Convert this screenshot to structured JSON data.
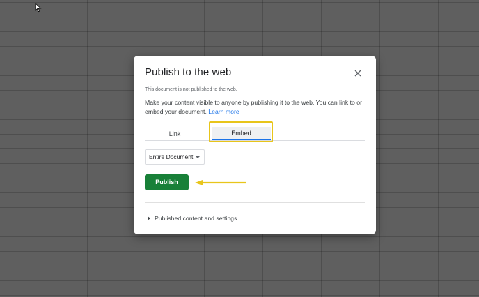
{
  "dialog": {
    "title": "Publish to the web",
    "status": "This document is not published to the web.",
    "description": "Make your content visible to anyone by publishing it to the web. You can link to or embed your document.",
    "learn_more": "Learn more",
    "tabs": [
      {
        "label": "Link",
        "active": false
      },
      {
        "label": "Embed",
        "active": true
      }
    ],
    "scope_select": {
      "value": "Entire Document"
    },
    "publish_label": "Publish",
    "settings_label": "Published content and settings"
  },
  "colors": {
    "publish_button": "#188038",
    "link": "#1a73e8",
    "annotation": "#e8c51b"
  },
  "icons": {
    "close": "close-icon",
    "dropdown": "caret-down-icon",
    "expand": "triangle-right-icon",
    "cursor": "mouse-pointer-icon"
  }
}
